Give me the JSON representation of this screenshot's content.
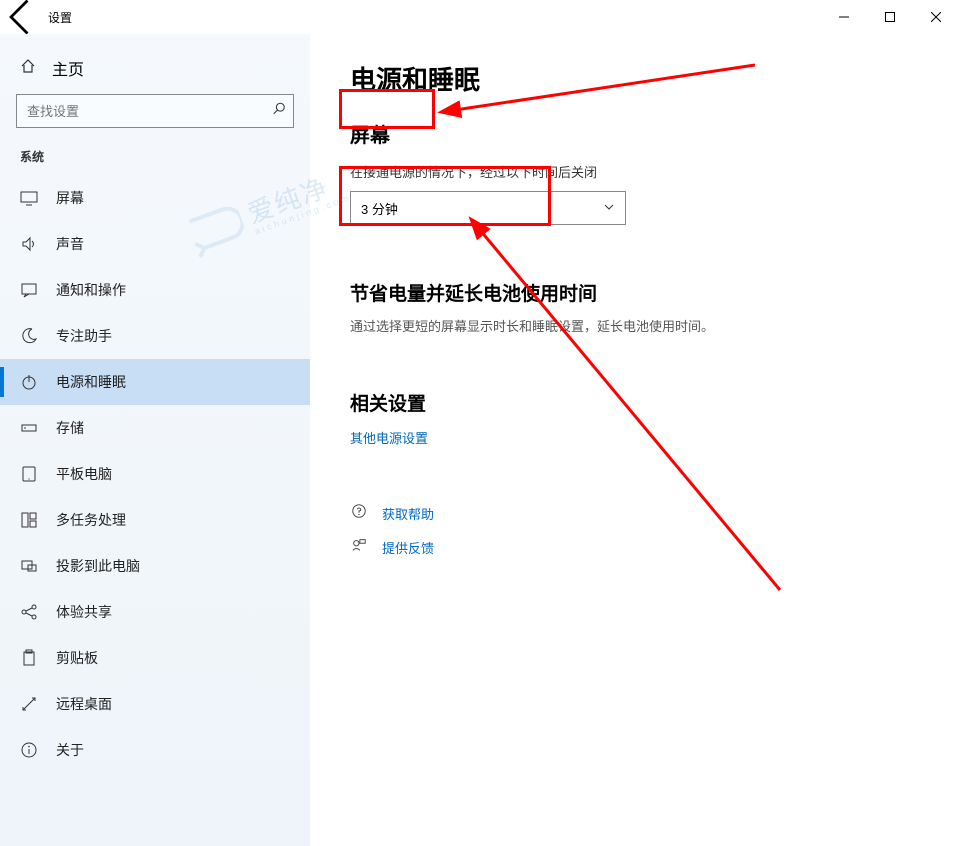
{
  "window": {
    "title": "设置"
  },
  "sidebar": {
    "home": "主页",
    "searchPlaceholder": "查找设置",
    "category": "系统",
    "items": [
      {
        "label": "屏幕"
      },
      {
        "label": "声音"
      },
      {
        "label": "通知和操作"
      },
      {
        "label": "专注助手"
      },
      {
        "label": "电源和睡眠"
      },
      {
        "label": "存储"
      },
      {
        "label": "平板电脑"
      },
      {
        "label": "多任务处理"
      },
      {
        "label": "投影到此电脑"
      },
      {
        "label": "体验共享"
      },
      {
        "label": "剪贴板"
      },
      {
        "label": "远程桌面"
      },
      {
        "label": "关于"
      }
    ]
  },
  "page": {
    "title": "电源和睡眠",
    "screenSection": "屏幕",
    "screenDesc": "在接通电源的情况下，经过以下时间后关闭",
    "screenValue": "3 分钟",
    "batteryTitle": "节省电量并延长电池使用时间",
    "batteryDesc": "通过选择更短的屏幕显示时长和睡眠设置，延长电池使用时间。",
    "relatedTitle": "相关设置",
    "relatedLink": "其他电源设置",
    "help": "获取帮助",
    "feedback": "提供反馈"
  },
  "watermark": {
    "main": "爱纯净",
    "sub": "aichunjing.com"
  }
}
